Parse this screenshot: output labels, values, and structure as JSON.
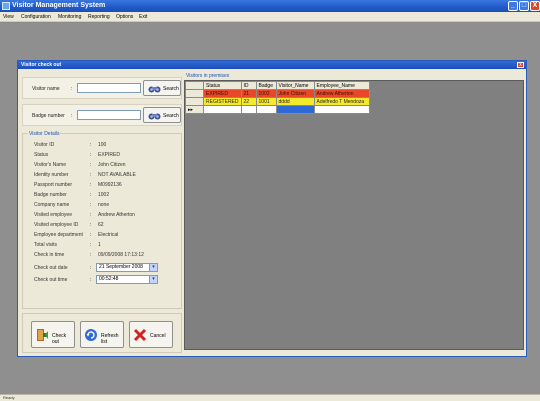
{
  "window": {
    "title": "Visitor Management System",
    "min": "_",
    "max": "□",
    "close": "X"
  },
  "menu": [
    "View",
    "Configuration",
    "Monitoring",
    "Reporting",
    "Options",
    "Exit"
  ],
  "dialog": {
    "title": "Visitor check out",
    "close": "x",
    "visitor_name": {
      "label": "Visitor name",
      "colon": ":",
      "value": "",
      "button": "Search"
    },
    "badge_number": {
      "label": "Badge number",
      "colon": ":",
      "value": "",
      "button": "Search"
    },
    "details_legend": "Visitor Details",
    "details": [
      {
        "key": "Visitor ID",
        "value": "100"
      },
      {
        "key": "Status",
        "value": "EXPIRED"
      },
      {
        "key": "Visitor's Name",
        "value": "John Citizen"
      },
      {
        "key": "Identity number",
        "value": "NOT AVAILABLE"
      },
      {
        "key": "Passport number",
        "value": "M0992136"
      },
      {
        "key": "Badge number",
        "value": "1002"
      },
      {
        "key": "Company name",
        "value": "none"
      },
      {
        "key": "Visited employee",
        "value": "Andrew Atherton"
      },
      {
        "key": "Visited employee ID",
        "value": "62"
      },
      {
        "key": "Employee department",
        "value": "Electrical"
      },
      {
        "key": "Total visits",
        "value": "1"
      },
      {
        "key": "Check in time",
        "value": "09/09/2008 17:13:12"
      }
    ],
    "checkout_date": {
      "key": "Check out date",
      "value": "21 September 2008"
    },
    "checkout_time": {
      "key": "Check out time",
      "value": "00:52:48"
    },
    "colon": ":",
    "buttons": {
      "checkout": "Check out",
      "refresh": "Refresh list",
      "cancel": "Cancel"
    },
    "grid": {
      "legend": "Visitors in premises",
      "columns": [
        "Status",
        "ID",
        "Badge",
        "Visitor_Name",
        "Employee_Name"
      ],
      "rows": [
        {
          "status": "EXPIRED",
          "id": "21",
          "badge": "1002",
          "visitor": "John Citizen",
          "employee": "Andrew Atherton"
        },
        {
          "status": "REGISTERED",
          "id": "22",
          "badge": "1001",
          "visitor": "dddd",
          "employee": "Adelfredo T Mendoza"
        }
      ],
      "new_row_marker": "▸▸"
    }
  },
  "status_bar": "Ready",
  "colors": {
    "expired": "#e8472a",
    "registered": "#f4ea2a",
    "selection": "#2e69d6",
    "title_blue": "#1f58c8"
  },
  "icons": [
    "binoculars-icon",
    "checkout-door-icon",
    "refresh-icon",
    "cancel-x-icon"
  ]
}
